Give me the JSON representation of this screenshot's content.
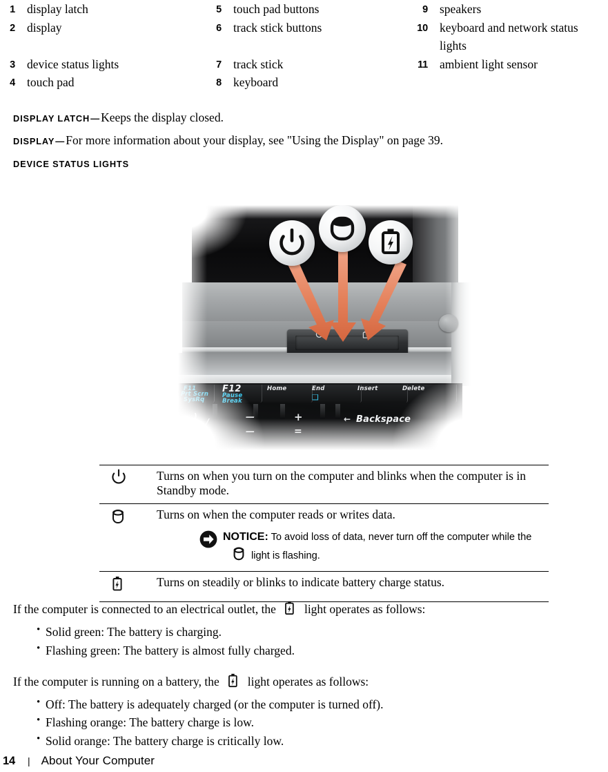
{
  "legend": {
    "columns": [
      [
        {
          "num": "1",
          "label": "display latch"
        },
        {
          "num": "2",
          "label": "display"
        },
        {
          "num": "3",
          "label": "device status lights"
        },
        {
          "num": "4",
          "label": "touch pad"
        }
      ],
      [
        {
          "num": "5",
          "label": "touch pad buttons"
        },
        {
          "num": "6",
          "label": "track stick buttons"
        },
        {
          "num": "7",
          "label": "track stick"
        },
        {
          "num": "8",
          "label": "keyboard"
        }
      ],
      [
        {
          "num": "9",
          "label": "speakers"
        },
        {
          "num": "10",
          "label": "keyboard and network status lights"
        },
        {
          "num": "11",
          "label": "ambient light sensor"
        }
      ]
    ]
  },
  "definitions": [
    {
      "term": "DISPLAY LATCH",
      "dash": "—",
      "text": "Keeps the display closed."
    },
    {
      "term": "DISPLAY",
      "dash": "—",
      "text": "For more information about your display, see \"Using the Display\" on page 39."
    },
    {
      "term": "DEVICE STATUS LIGHTS",
      "dash": "",
      "text": ""
    }
  ],
  "photo": {
    "caption_alt": "Dell laptop status lights close-up with three callout badges",
    "arrow_color": "#e0784f",
    "badges": [
      {
        "icon": "power-icon"
      },
      {
        "icon": "hard-drive-icon"
      },
      {
        "icon": "battery-icon"
      }
    ],
    "keyboard_labels": {
      "prtscn_top": "F11",
      "prtscn_mid": "Prt Scrn",
      "prtscn_bot": "SysRq",
      "f12": "F12",
      "pause": "Pause",
      "break": "Break",
      "home": "Home",
      "end": "End",
      "insert": "Insert",
      "delete": "Delete",
      "paren": ")",
      "zero": "0",
      "slash": "/",
      "minus_top": "—",
      "minus_bot": "—",
      "plus": "+",
      "equals": "=",
      "backspace": "Backspace",
      "backspace_arrow": "←"
    },
    "tiny_leds": [
      "⏻",
      "⛃",
      "▯"
    ]
  },
  "light_table": {
    "rows": [
      {
        "icon": "power-icon",
        "text": "Turns on when you turn on the computer and blinks when the computer is in Standby mode."
      },
      {
        "icon": "hard-drive-icon",
        "text": "Turns on when the computer reads or writes data.",
        "notice": {
          "icon": "notice-arrow-icon",
          "label": "NOTICE:",
          "line1": "To avoid loss of data, never turn off the computer while the",
          "inline_icon": "hard-drive-icon",
          "line2": "light is flashing."
        }
      },
      {
        "icon": "battery-icon",
        "text": "Turns on steadily or blinks to indicate battery charge status."
      }
    ]
  },
  "tail": {
    "para1_before": "If the computer is connected to an electrical outlet, the",
    "para1_icon": "battery-icon",
    "para1_after": "light operates as follows:",
    "bullets1": [
      "Solid green: The battery is charging.",
      "Flashing green: The battery is almost fully charged."
    ],
    "para2_before": "If the computer is running on a battery, the",
    "para2_icon": "battery-icon",
    "para2_after": "light operates as follows:",
    "bullets2": [
      "Off: The battery is adequately charged (or the computer is turned off).",
      "Flashing orange: The battery charge is low.",
      "Solid orange: The battery charge is critically low."
    ]
  },
  "footer": {
    "page_number": "14",
    "separator": "|",
    "section_title": "About Your Computer"
  }
}
